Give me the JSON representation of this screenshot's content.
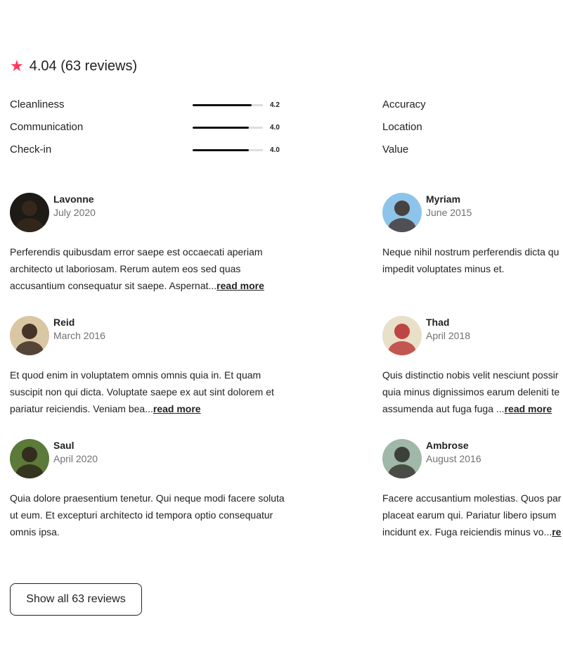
{
  "header": {
    "rating_text": "4.04 (63 reviews)",
    "star_icon": "star-icon",
    "star_color": "#ff385c"
  },
  "categories": [
    {
      "label": "Cleanliness",
      "score": "4.2",
      "fill": 0.84
    },
    {
      "label": "Communication",
      "score": "4.0",
      "fill": 0.8
    },
    {
      "label": "Check-in",
      "score": "4.0",
      "fill": 0.8
    },
    {
      "label": "Accuracy"
    },
    {
      "label": "Location"
    },
    {
      "label": "Value"
    }
  ],
  "reviews": [
    {
      "name": "Lavonne",
      "date": "July 2020",
      "lines": [
        "Perferendis quibusdam error saepe est occaecati aperiam",
        "architecto ut laboriosam. Rerum autem eos sed quas",
        "accusantium consequatur sit saepe. Aspernat..."
      ],
      "read_more": "read more",
      "avatar_colors": [
        "#1e1a16",
        "#3a2a1c"
      ]
    },
    {
      "name": "Myriam",
      "date": "June 2015",
      "lines": [
        "Neque nihil nostrum perferendis dicta qu",
        "impedit voluptates minus et."
      ],
      "avatar_colors": [
        "#8fc4ea",
        "#3b2a22"
      ]
    },
    {
      "name": "Reid",
      "date": "March 2016",
      "lines": [
        "Et quod enim in voluptatem omnis omnis quia in. Et quam",
        "suscipit non qui dicta. Voluptate saepe ex aut sint dolorem et",
        "pariatur reiciendis. Veniam bea..."
      ],
      "read_more": "read more",
      "avatar_colors": [
        "#d9c7a3",
        "#2a1a12"
      ]
    },
    {
      "name": "Thad",
      "date": "April 2018",
      "lines": [
        "Quis distinctio nobis velit nesciunt possir",
        "quia minus dignissimos earum deleniti te",
        "assumenda aut fuga fuga ..."
      ],
      "read_more": "read more",
      "avatar_colors": [
        "#e8e0c8",
        "#b52a2a"
      ]
    },
    {
      "name": "Saul",
      "date": "April 2020",
      "lines": [
        "Quia dolore praesentium tenetur. Qui neque modi facere soluta",
        "ut eum. Et excepturi architecto id tempora optio consequatur",
        "omnis ipsa."
      ],
      "avatar_colors": [
        "#5c7a3a",
        "#2a2018"
      ]
    },
    {
      "name": "Ambrose",
      "date": "August 2016",
      "lines": [
        "Facere accusantium molestias. Quos par",
        "placeat earum qui. Pariatur libero ipsum",
        "incidunt ex. Fuga reiciendis minus vo..."
      ],
      "read_more": "re",
      "avatar_colors": [
        "#9fb8a8",
        "#2c2a24"
      ]
    }
  ],
  "show_all_label": "Show all 63 reviews"
}
